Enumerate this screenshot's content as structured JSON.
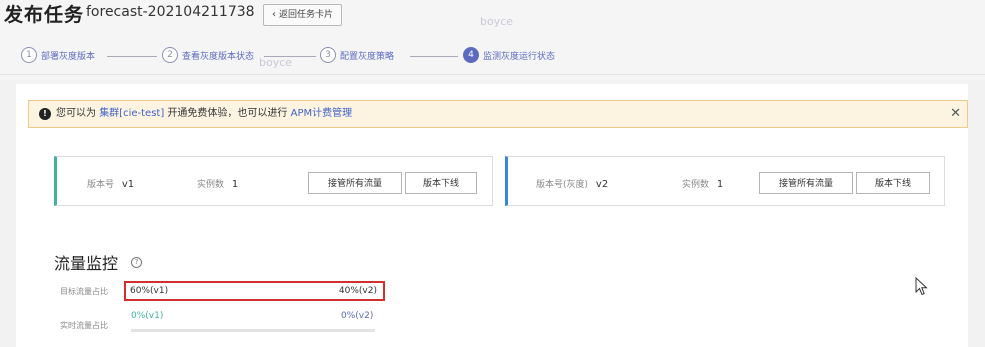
{
  "header": {
    "title": "发布任务",
    "task_id": "forecast-202104211738",
    "back_button": "返回任务卡片"
  },
  "watermarks": [
    "boyce",
    "boyce",
    "boyce"
  ],
  "steps": [
    {
      "num": "1",
      "label": "部署灰度版本"
    },
    {
      "num": "2",
      "label": "查看灰度版本状态"
    },
    {
      "num": "3",
      "label": "配置灰度策略"
    },
    {
      "num": "4",
      "label": "监测灰度运行状态"
    }
  ],
  "notice": {
    "prefix": "您可以为",
    "cluster_link": "集群[cie-test]",
    "middle": "开通免费体验，也可以进行",
    "apm_link": "APM计费管理"
  },
  "cards": [
    {
      "version_label": "版本号",
      "version_value": "v1",
      "instances_label": "实例数",
      "instances_value": "1",
      "takeover_button": "接管所有流量",
      "offline_button": "版本下线"
    },
    {
      "version_label": "版本号(灰度)",
      "version_value": "v2",
      "instances_label": "实例数",
      "instances_value": "1",
      "takeover_button": "接管所有流量",
      "offline_button": "版本下线"
    }
  ],
  "traffic": {
    "title": "流量监控",
    "target_label": "目标流量占比",
    "target_v1": "60%(v1)",
    "target_v2": "40%(v2)",
    "live_label": "实时流量占比",
    "live_v1": "0%(v1)",
    "live_v2": "0%(v2)"
  },
  "colors": {
    "accent": "#5c6bc0",
    "card1_stripe": "#3db49b",
    "card2_stripe": "#3a86d8",
    "highlight": "#d0312d",
    "notice_bg": "#fdf3e1"
  }
}
